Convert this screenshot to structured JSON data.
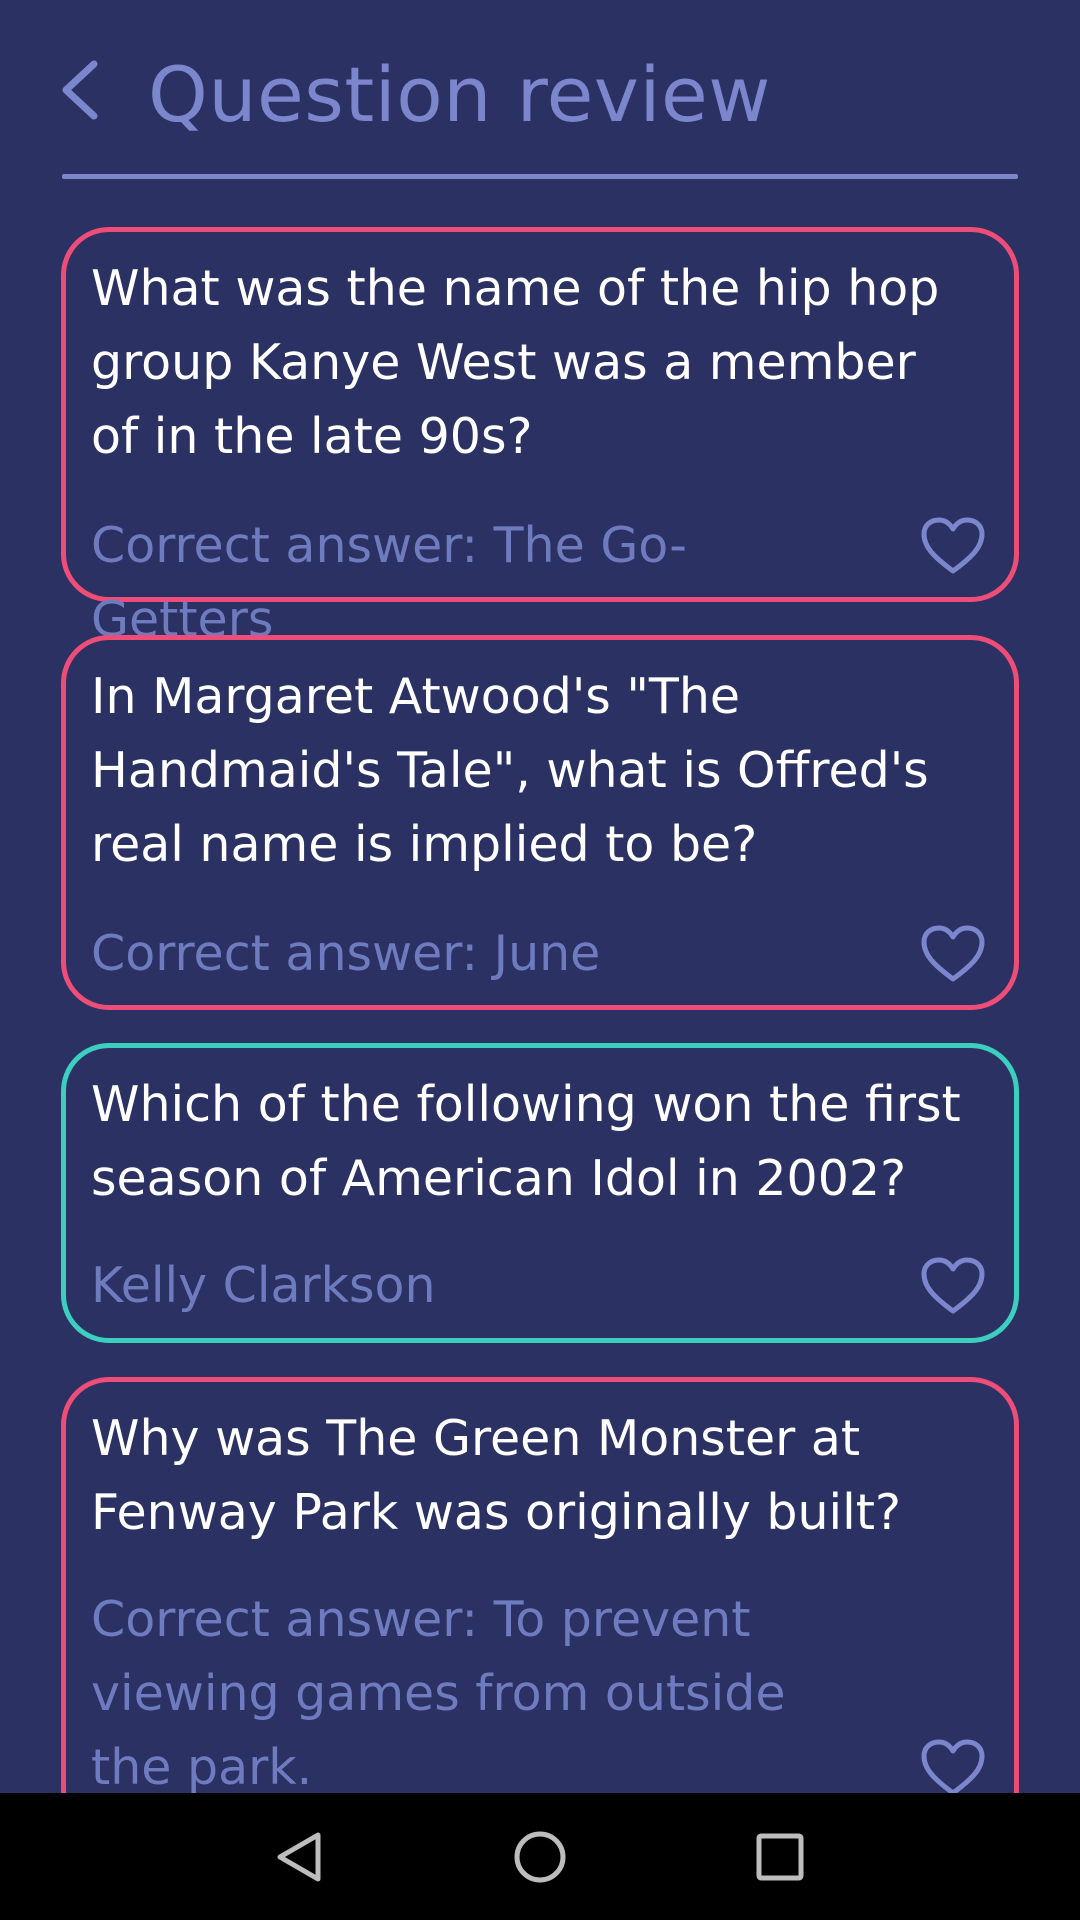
{
  "header": {
    "title": "Question review",
    "back_icon": "chevron-left-icon"
  },
  "colors": {
    "background": "#2b3263",
    "accent": "#7b86cc",
    "incorrect_border": "#ee4d78",
    "correct_border": "#3ccfc0",
    "question_text": "#ffffff",
    "answer_text": "#6f7bbf"
  },
  "questions": [
    {
      "question": "What was the name of the hip hop group Kanye West was a member of in the late 90s?",
      "answer": "Correct answer: The Go-Getters",
      "status": "incorrect",
      "favorite_icon": "heart-outline-icon"
    },
    {
      "question": "In Margaret Atwood's \"The Handmaid's Tale\", what is Offred's real name is implied to be?",
      "answer": "Correct answer: June",
      "status": "incorrect",
      "favorite_icon": "heart-outline-icon"
    },
    {
      "question": "Which of the following won the first season of American Idol in 2002?",
      "answer": "Kelly Clarkson",
      "status": "correct",
      "favorite_icon": "heart-outline-icon"
    },
    {
      "question": "Why was The Green Monster at Fenway Park was originally built?",
      "answer": "Correct answer: To prevent viewing games from outside the park.",
      "status": "incorrect",
      "favorite_icon": "heart-outline-icon"
    }
  ],
  "navbar": {
    "back_icon": "triangle-back-icon",
    "home_icon": "circle-home-icon",
    "recents_icon": "square-recents-icon"
  }
}
